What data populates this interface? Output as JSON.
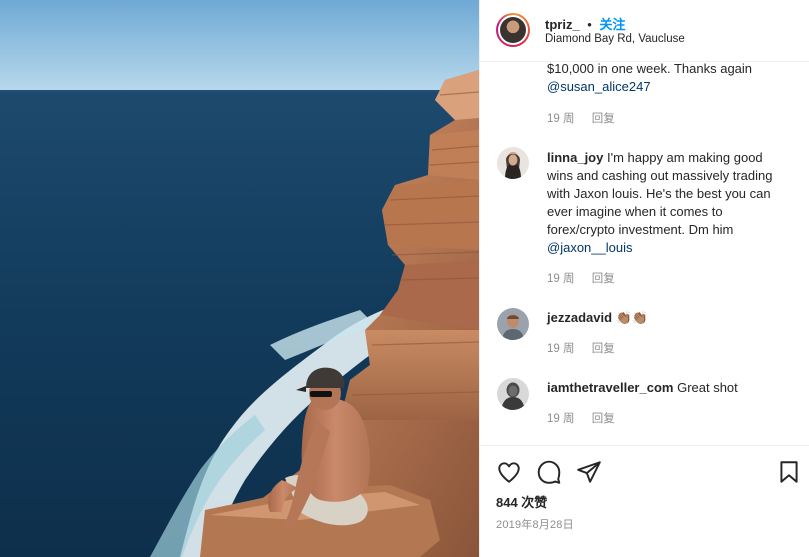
{
  "post": {
    "username": "tpriz_",
    "separator": "•",
    "follow_label": "关注",
    "location": "Diamond Bay Rd, Vaucluse"
  },
  "comments": [
    {
      "username": "",
      "text": "$10,000 in one week. Thanks again",
      "mention": "@susan_alice247",
      "time": "19 周",
      "reply_label": "回复"
    },
    {
      "username": "linna_joy",
      "text": "I'm happy am making good wins and cashing out massively trading with Jaxon louis. He's the best you can ever imagine when it comes to forex/crypto investment. Dm him",
      "mention": "@jaxon__louis",
      "time": "19 周",
      "reply_label": "回复"
    },
    {
      "username": "jezzadavid",
      "text": "👏🏽👏🏽",
      "time": "19 周",
      "reply_label": "回复"
    },
    {
      "username": "iamthetraveller_com",
      "text": "Great shot",
      "time": "19 周",
      "reply_label": "回复"
    }
  ],
  "actions": {
    "icons": [
      "heart-icon",
      "comment-icon",
      "share-icon",
      "bookmark-icon"
    ]
  },
  "likes": "844 次赞",
  "date": "2019年8月28日",
  "colors": {
    "link": "#00376b",
    "follow": "#0095f6",
    "muted": "#8e8e8e",
    "text": "#262626",
    "sea": "#123a5a",
    "sky": "#8fc1e0",
    "cliff": "#c68a62"
  }
}
